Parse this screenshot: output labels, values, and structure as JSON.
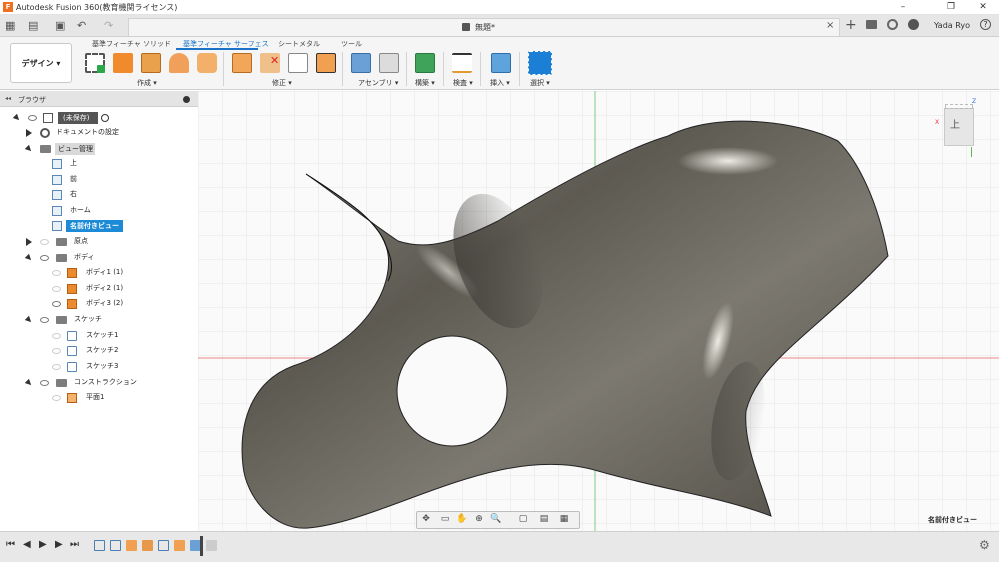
{
  "titlebar": {
    "app_title": "Autodesk Fusion 360(教育機関ライセンス)",
    "logo": "F",
    "minimize": "–",
    "maximize": "❐",
    "close": "✕"
  },
  "quick_access": {
    "grid_icon": "▦",
    "file_icon": "▤",
    "save_icon": "▣",
    "undo_icon": "↶",
    "redo_icon": "↷",
    "document_title": "無題*",
    "tab_close": "×",
    "new_tab": "+",
    "user_name": "Yada Ryo",
    "help_icon": "?"
  },
  "ribbon": {
    "workspace": "デザイン ▾",
    "tabs": [
      "基準フィーチャ ソリッド",
      "基準フィーチャ サーフェス",
      "シートメタル",
      "ツール"
    ],
    "active_tab": 1,
    "groups": [
      "作成 ▾",
      "修正 ▾",
      "アセンブリ ▾",
      "構築 ▾",
      "検査 ▾",
      "挿入 ▾",
      "選択 ▾"
    ]
  },
  "browser": {
    "title": "ブラウザ",
    "collapse": "◂◂",
    "items": [
      {
        "label": "(未保存)"
      },
      {
        "label": "ドキュメントの設定"
      },
      {
        "label": "ビュー管理"
      },
      {
        "label": "上"
      },
      {
        "label": "前"
      },
      {
        "label": "右"
      },
      {
        "label": "ホーム"
      },
      {
        "label": "名前付きビュー"
      },
      {
        "label": "原点"
      },
      {
        "label": "ボディ"
      },
      {
        "label": "ボディ1 (1)"
      },
      {
        "label": "ボディ2 (1)"
      },
      {
        "label": "ボディ3 (2)"
      },
      {
        "label": "スケッチ"
      },
      {
        "label": "スケッチ1"
      },
      {
        "label": "スケッチ2"
      },
      {
        "label": "スケッチ3"
      },
      {
        "label": "コンストラクション"
      },
      {
        "label": "平面1"
      }
    ]
  },
  "canvas": {
    "viewcube_face": "上",
    "axis_x": "X",
    "axis_z": "Z",
    "view_name": "名前付きビュー"
  },
  "navbar": {
    "icons": [
      "✥",
      "▭",
      "✋",
      "⊕",
      "🔍",
      "▢",
      "▤",
      "▦"
    ]
  },
  "timeline": {
    "first": "⏮",
    "prev": "◀",
    "play": "▶",
    "next": "▶",
    "last": "⏭",
    "settings": "⚙"
  },
  "colors": {
    "accent": "#1a73c9",
    "surface": "#6b6860",
    "grid": "#e2e2e2"
  }
}
